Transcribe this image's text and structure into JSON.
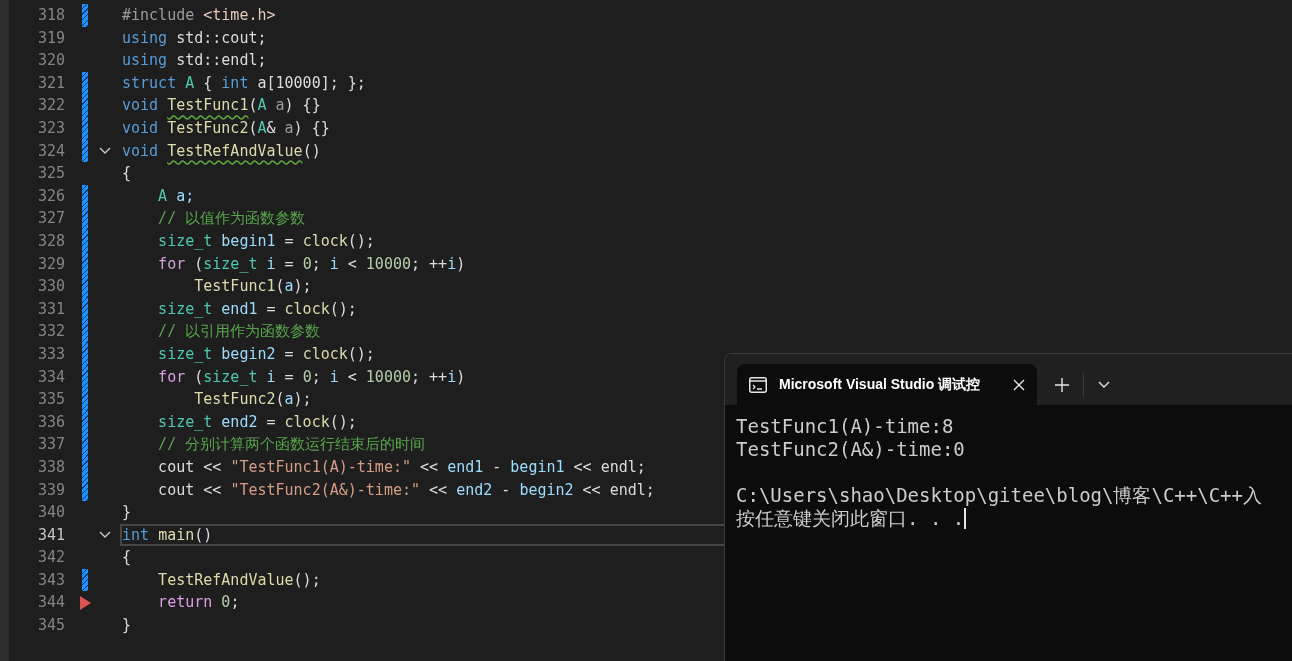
{
  "editor": {
    "lines": [
      {
        "number": "318",
        "changed": true,
        "current": false,
        "arrow": false,
        "tokens": [
          {
            "text": "#include ",
            "kind": "macro"
          },
          {
            "text": "<time.h>",
            "kind": "header"
          }
        ]
      },
      {
        "number": "319",
        "changed": false,
        "current": false,
        "arrow": false,
        "tokens": [
          {
            "text": "using ",
            "kind": "kw"
          },
          {
            "text": "std::cout;",
            "kind": "plain"
          }
        ]
      },
      {
        "number": "320",
        "changed": false,
        "current": false,
        "arrow": false,
        "tokens": [
          {
            "text": "using ",
            "kind": "kw"
          },
          {
            "text": "std::endl;",
            "kind": "plain"
          }
        ]
      },
      {
        "number": "321",
        "changed": true,
        "current": false,
        "arrow": false,
        "tokens": [
          {
            "text": "struct ",
            "kind": "kw"
          },
          {
            "text": "A",
            "kind": "type"
          },
          {
            "text": " { ",
            "kind": "plain"
          },
          {
            "text": "int ",
            "kind": "kw"
          },
          {
            "text": "a",
            "kind": "plain"
          },
          {
            "text": "[10000]; };",
            "kind": "plain"
          }
        ]
      },
      {
        "number": "322",
        "changed": true,
        "current": false,
        "arrow": false,
        "tokens": [
          {
            "text": "void ",
            "kind": "kw"
          },
          {
            "text": "TestFunc1",
            "kind": "func-warn"
          },
          {
            "text": "(",
            "kind": "plain"
          },
          {
            "text": "A ",
            "kind": "type"
          },
          {
            "text": "a",
            "kind": "param"
          },
          {
            "text": ") {}",
            "kind": "plain"
          }
        ]
      },
      {
        "number": "323",
        "changed": true,
        "current": false,
        "arrow": false,
        "tokens": [
          {
            "text": "void ",
            "kind": "kw"
          },
          {
            "text": "TestFunc2",
            "kind": "func"
          },
          {
            "text": "(",
            "kind": "plain"
          },
          {
            "text": "A",
            "kind": "type"
          },
          {
            "text": "& ",
            "kind": "plain"
          },
          {
            "text": "a",
            "kind": "param"
          },
          {
            "text": ") {}",
            "kind": "plain"
          }
        ]
      },
      {
        "number": "324",
        "changed": true,
        "current": false,
        "expanded": true,
        "arrow": false,
        "tokens": [
          {
            "text": "void ",
            "kind": "kw"
          },
          {
            "text": "TestRefAndValue",
            "kind": "func-warn"
          },
          {
            "text": "()",
            "kind": "plain"
          }
        ]
      },
      {
        "number": "325",
        "changed": false,
        "current": false,
        "arrow": false,
        "tokens": [
          {
            "text": "{",
            "kind": "plain"
          }
        ]
      },
      {
        "number": "326",
        "changed": true,
        "current": false,
        "arrow": false,
        "tokens": [
          {
            "text": "    A ",
            "kind": "type"
          },
          {
            "text": "a;",
            "kind": "var"
          }
        ]
      },
      {
        "number": "327",
        "changed": true,
        "current": false,
        "arrow": false,
        "tokens": [
          {
            "text": "    // 以值作为函数参数",
            "kind": "comment"
          }
        ]
      },
      {
        "number": "328",
        "changed": true,
        "current": false,
        "arrow": false,
        "tokens": [
          {
            "text": "    size_t ",
            "kind": "type"
          },
          {
            "text": "begin1",
            "kind": "var"
          },
          {
            "text": " = ",
            "kind": "plain"
          },
          {
            "text": "clock",
            "kind": "func"
          },
          {
            "text": "();",
            "kind": "plain"
          }
        ]
      },
      {
        "number": "329",
        "changed": true,
        "current": false,
        "arrow": false,
        "tokens": [
          {
            "text": "    for ",
            "kind": "ctrl"
          },
          {
            "text": "(",
            "kind": "plain"
          },
          {
            "text": "size_t ",
            "kind": "type"
          },
          {
            "text": "i",
            "kind": "var"
          },
          {
            "text": " = ",
            "kind": "plain"
          },
          {
            "text": "0",
            "kind": "num"
          },
          {
            "text": "; ",
            "kind": "plain"
          },
          {
            "text": "i",
            "kind": "var"
          },
          {
            "text": " < ",
            "kind": "plain"
          },
          {
            "text": "10000",
            "kind": "num"
          },
          {
            "text": "; ++",
            "kind": "plain"
          },
          {
            "text": "i",
            "kind": "var"
          },
          {
            "text": ")",
            "kind": "plain"
          }
        ]
      },
      {
        "number": "330",
        "changed": true,
        "current": false,
        "arrow": false,
        "tokens": [
          {
            "text": "        TestFunc1",
            "kind": "func"
          },
          {
            "text": "(",
            "kind": "plain"
          },
          {
            "text": "a",
            "kind": "var"
          },
          {
            "text": ");",
            "kind": "plain"
          }
        ]
      },
      {
        "number": "331",
        "changed": true,
        "current": false,
        "arrow": false,
        "tokens": [
          {
            "text": "    size_t ",
            "kind": "type"
          },
          {
            "text": "end1",
            "kind": "var"
          },
          {
            "text": " = ",
            "kind": "plain"
          },
          {
            "text": "clock",
            "kind": "func"
          },
          {
            "text": "();",
            "kind": "plain"
          }
        ]
      },
      {
        "number": "332",
        "changed": true,
        "current": false,
        "arrow": false,
        "tokens": [
          {
            "text": "    // 以引用作为函数参数",
            "kind": "comment"
          }
        ]
      },
      {
        "number": "333",
        "changed": true,
        "current": false,
        "arrow": false,
        "tokens": [
          {
            "text": "    size_t ",
            "kind": "type"
          },
          {
            "text": "begin2",
            "kind": "var"
          },
          {
            "text": " = ",
            "kind": "plain"
          },
          {
            "text": "clock",
            "kind": "func"
          },
          {
            "text": "();",
            "kind": "plain"
          }
        ]
      },
      {
        "number": "334",
        "changed": true,
        "current": false,
        "arrow": false,
        "tokens": [
          {
            "text": "    for ",
            "kind": "ctrl"
          },
          {
            "text": "(",
            "kind": "plain"
          },
          {
            "text": "size_t ",
            "kind": "type"
          },
          {
            "text": "i",
            "kind": "var"
          },
          {
            "text": " = ",
            "kind": "plain"
          },
          {
            "text": "0",
            "kind": "num"
          },
          {
            "text": "; ",
            "kind": "plain"
          },
          {
            "text": "i",
            "kind": "var"
          },
          {
            "text": " < ",
            "kind": "plain"
          },
          {
            "text": "10000",
            "kind": "num"
          },
          {
            "text": "; ++",
            "kind": "plain"
          },
          {
            "text": "i",
            "kind": "var"
          },
          {
            "text": ")",
            "kind": "plain"
          }
        ]
      },
      {
        "number": "335",
        "changed": true,
        "current": false,
        "arrow": false,
        "tokens": [
          {
            "text": "        TestFunc2",
            "kind": "func"
          },
          {
            "text": "(",
            "kind": "plain"
          },
          {
            "text": "a",
            "kind": "var"
          },
          {
            "text": ");",
            "kind": "plain"
          }
        ]
      },
      {
        "number": "336",
        "changed": true,
        "current": false,
        "arrow": false,
        "tokens": [
          {
            "text": "    size_t ",
            "kind": "type"
          },
          {
            "text": "end2",
            "kind": "var"
          },
          {
            "text": " = ",
            "kind": "plain"
          },
          {
            "text": "clock",
            "kind": "func"
          },
          {
            "text": "();",
            "kind": "plain"
          }
        ]
      },
      {
        "number": "337",
        "changed": true,
        "current": false,
        "arrow": false,
        "tokens": [
          {
            "text": "    // 分别计算两个函数运行结束后的时间",
            "kind": "comment"
          }
        ]
      },
      {
        "number": "338",
        "changed": true,
        "current": false,
        "arrow": false,
        "tokens": [
          {
            "text": "    cout ",
            "kind": "plain"
          },
          {
            "text": "<< ",
            "kind": "plain"
          },
          {
            "text": "\"TestFunc1(A)-time:\"",
            "kind": "str"
          },
          {
            "text": " << ",
            "kind": "plain"
          },
          {
            "text": "end1",
            "kind": "var"
          },
          {
            "text": " - ",
            "kind": "plain"
          },
          {
            "text": "begin1",
            "kind": "var"
          },
          {
            "text": " << ",
            "kind": "plain"
          },
          {
            "text": "endl;",
            "kind": "plain"
          }
        ]
      },
      {
        "number": "339",
        "changed": true,
        "current": false,
        "arrow": false,
        "tokens": [
          {
            "text": "    cout ",
            "kind": "plain"
          },
          {
            "text": "<< ",
            "kind": "plain"
          },
          {
            "text": "\"TestFunc2(A&)-time:\"",
            "kind": "str"
          },
          {
            "text": " << ",
            "kind": "plain"
          },
          {
            "text": "end2",
            "kind": "var"
          },
          {
            "text": " - ",
            "kind": "plain"
          },
          {
            "text": "begin2",
            "kind": "var"
          },
          {
            "text": " << ",
            "kind": "plain"
          },
          {
            "text": "endl;",
            "kind": "plain"
          }
        ]
      },
      {
        "number": "340",
        "changed": false,
        "current": false,
        "arrow": false,
        "tokens": [
          {
            "text": "}",
            "kind": "plain"
          }
        ]
      },
      {
        "number": "341",
        "changed": false,
        "current": true,
        "expanded": true,
        "arrow": false,
        "tokens": [
          {
            "text": "int ",
            "kind": "kw"
          },
          {
            "text": "main",
            "kind": "func"
          },
          {
            "text": "()",
            "kind": "plain"
          }
        ]
      },
      {
        "number": "342",
        "changed": false,
        "current": false,
        "arrow": false,
        "tokens": [
          {
            "text": "{",
            "kind": "plain"
          }
        ]
      },
      {
        "number": "343",
        "changed": true,
        "current": false,
        "arrow": false,
        "tokens": [
          {
            "text": "    TestRefAndValue",
            "kind": "func"
          },
          {
            "text": "();",
            "kind": "plain"
          }
        ]
      },
      {
        "number": "344",
        "changed": false,
        "current": false,
        "arrow": true,
        "tokens": [
          {
            "text": "    return ",
            "kind": "ctrl"
          },
          {
            "text": "0",
            "kind": "num"
          },
          {
            "text": ";",
            "kind": "plain"
          }
        ]
      },
      {
        "number": "345",
        "changed": false,
        "current": false,
        "arrow": false,
        "tokens": [
          {
            "text": "}",
            "kind": "plain"
          }
        ]
      }
    ]
  },
  "terminal": {
    "tab": {
      "title": "Microsoft Visual Studio 调试控",
      "selected": true
    },
    "output": [
      "TestFunc1(A)-time:8",
      "TestFunc2(A&)-time:0"
    ],
    "prompt": [
      "C:\\Users\\shao\\Desktop\\gitee\\blog\\博客\\C++\\C++入",
      "按任意键关闭此窗口. . ."
    ]
  }
}
